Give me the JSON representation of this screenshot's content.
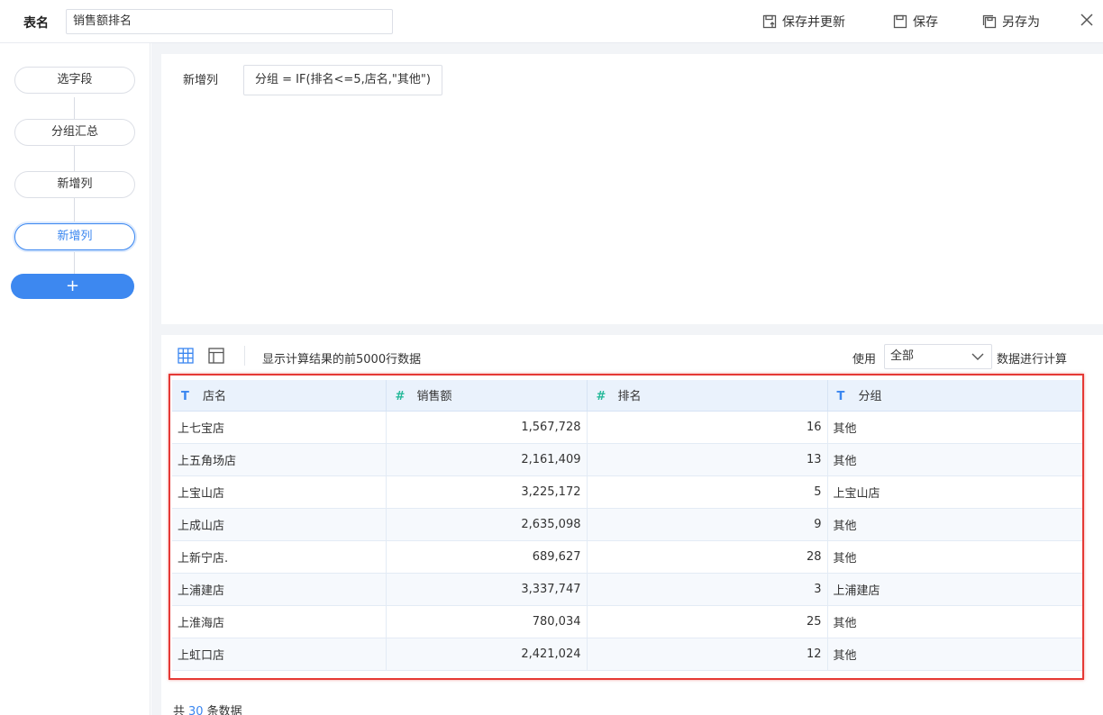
{
  "header": {
    "table_name_label": "表名",
    "table_name_value": "销售额排名",
    "save_update_label": "保存并更新",
    "save_label": "保存",
    "save_as_label": "另存为"
  },
  "steps": [
    "选字段",
    "分组汇总",
    "新增列",
    "新增列"
  ],
  "add_step_label": "+",
  "formula": {
    "label": "新增列",
    "expression": "分组 = IF(排名<=5,店名,\"其他\")"
  },
  "preview": {
    "info": "显示计算结果的前5000行数据",
    "use_label": "使用",
    "use_value": "全部",
    "calc_label": "数据进行计算"
  },
  "table": {
    "columns": [
      {
        "type_icon": "T",
        "name": "店名"
      },
      {
        "type_icon": "#",
        "name": "销售额"
      },
      {
        "type_icon": "#",
        "name": "排名"
      },
      {
        "type_icon": "T",
        "name": "分组"
      }
    ],
    "rows": [
      [
        "上七宝店",
        "1,567,728",
        "16",
        "其他"
      ],
      [
        "上五角场店",
        "2,161,409",
        "13",
        "其他"
      ],
      [
        "上宝山店",
        "3,225,172",
        "5",
        "上宝山店"
      ],
      [
        "上成山店",
        "2,635,098",
        "9",
        "其他"
      ],
      [
        "上新宁店.",
        "689,627",
        "28",
        "其他"
      ],
      [
        "上浦建店",
        "3,337,747",
        "3",
        "上浦建店"
      ],
      [
        "上淮海店",
        "780,034",
        "25",
        "其他"
      ],
      [
        "上虹口店",
        "2,421,024",
        "12",
        "其他"
      ]
    ]
  },
  "footer": {
    "prefix": "共",
    "count": "30",
    "suffix": "条数据"
  },
  "colors": {
    "accent": "#3a86f0",
    "highlight_box": "#e53935",
    "number_icon": "#26b99a"
  }
}
